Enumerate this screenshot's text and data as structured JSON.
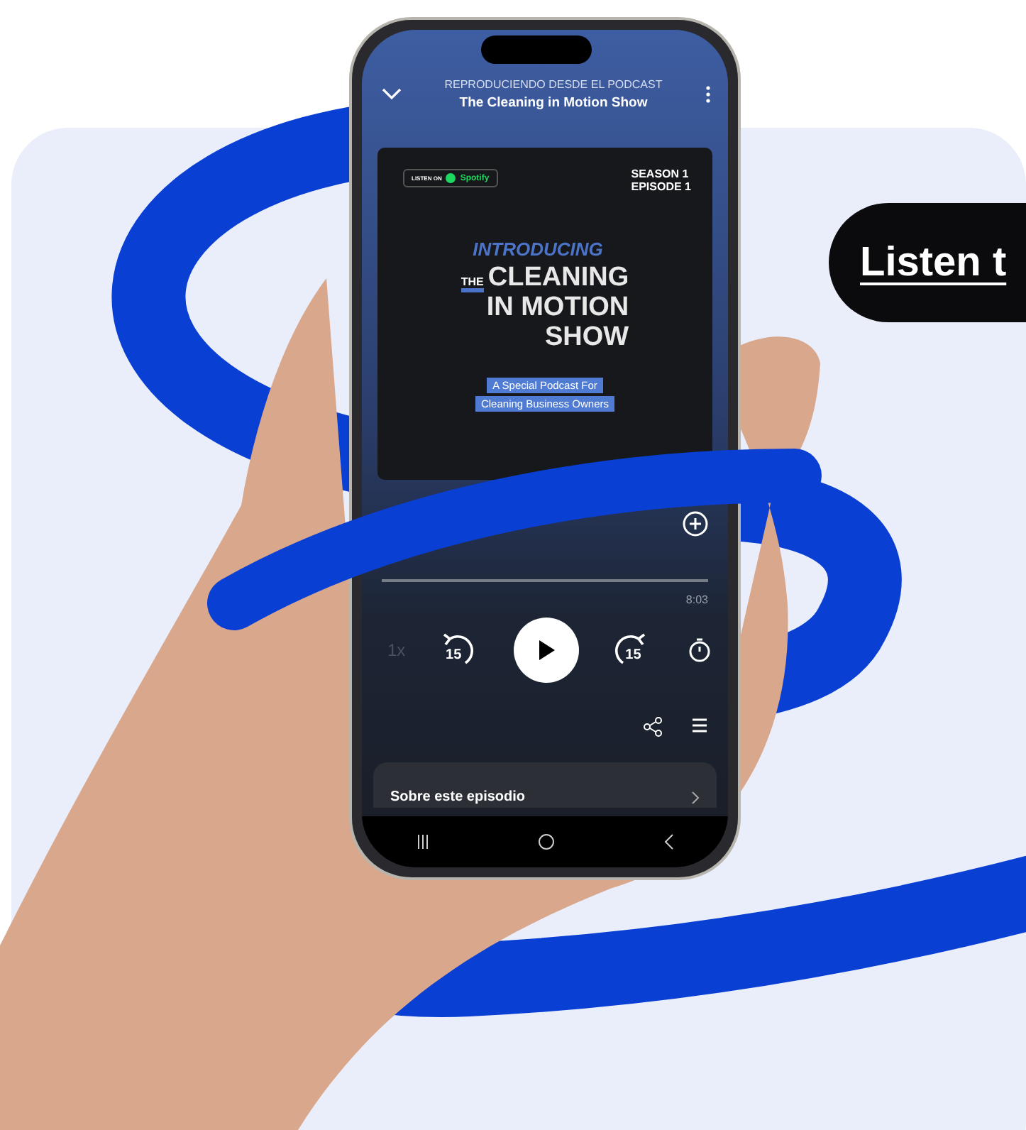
{
  "cta": {
    "label": "Listen t"
  },
  "phone": {
    "header": {
      "context": "REPRODUCIENDO DESDE EL PODCAST",
      "title": "The Cleaning in Motion Show"
    },
    "cover": {
      "badge": "LISTEN ON",
      "brand": "Spotify",
      "season": "SEASON 1",
      "episode": "EPISODE 1",
      "intro": "INTRODUCING",
      "title_small": "THE",
      "title_lines": [
        "CLEANING",
        "IN MOTION",
        "SHOW"
      ],
      "subtitle_lines": [
        "A Special Podcast For",
        "Cleaning Business Owners"
      ]
    },
    "duration": "8:03",
    "speed": "1x",
    "skip_back": "15",
    "skip_forward": "15",
    "about": "Sobre este episodio"
  }
}
